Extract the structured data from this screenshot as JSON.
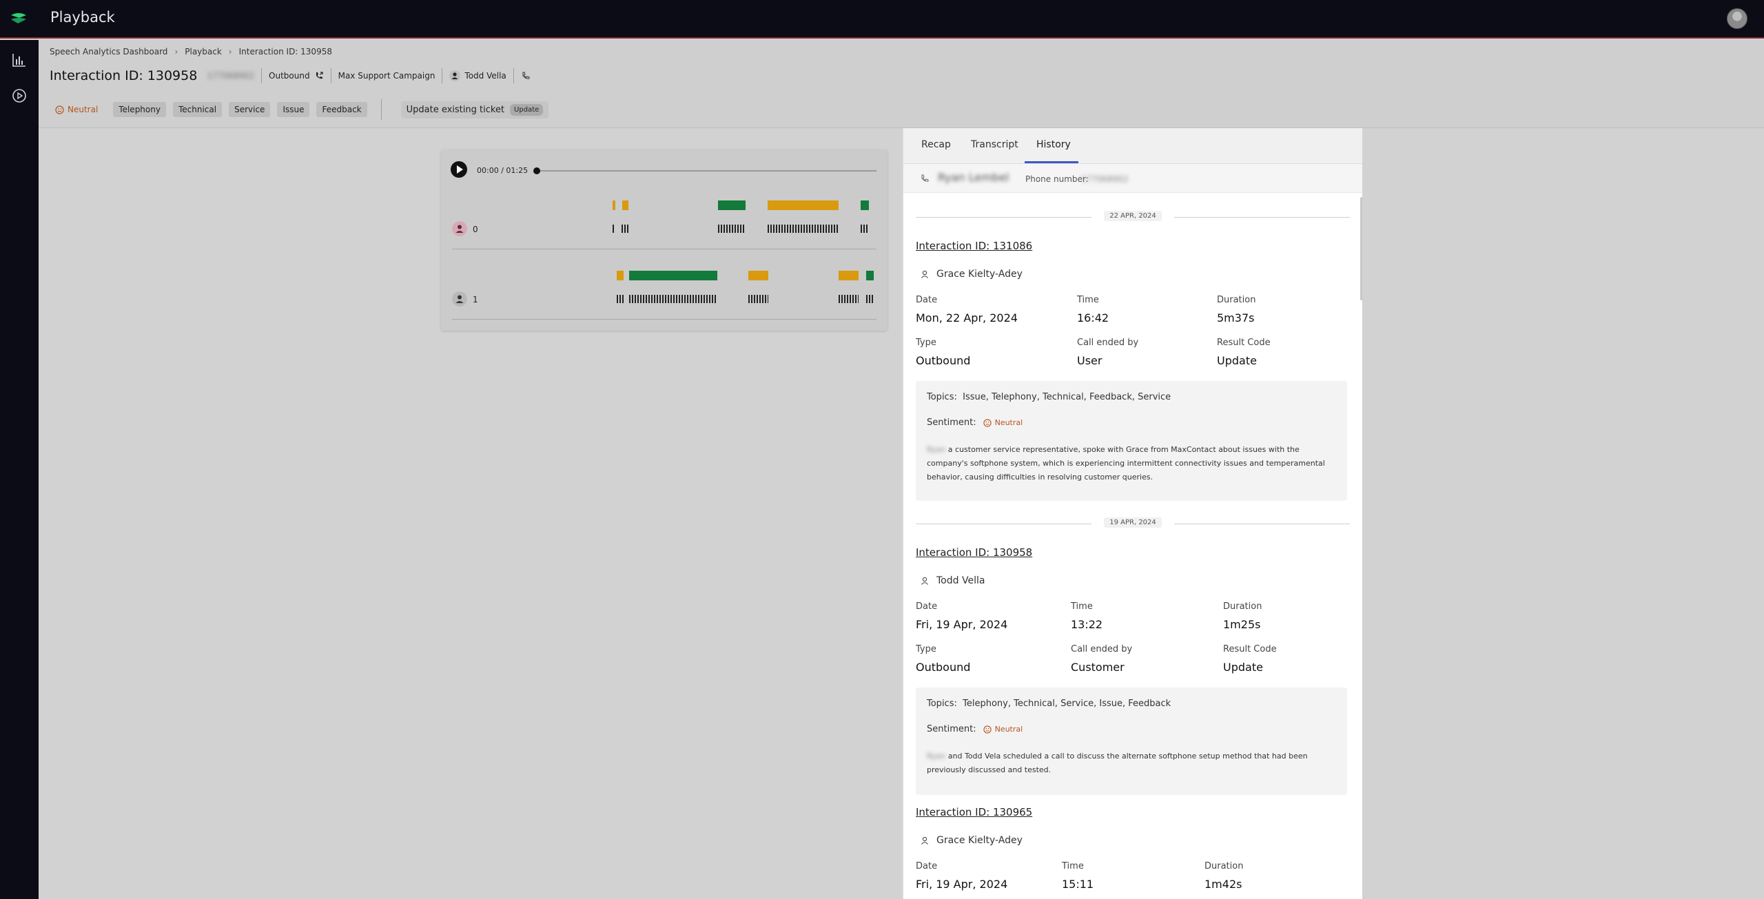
{
  "app": {
    "title": "Playback"
  },
  "breadcrumb": [
    "Speech Analytics Dashboard",
    "Playback",
    "Interaction ID: 130958"
  ],
  "header": {
    "title": "Interaction ID: 130958",
    "hidden_id": "177068902",
    "direction": "Outbound",
    "campaign": "Max Support Campaign",
    "agent": "Todd Vella",
    "sentiment": "Neutral",
    "tags": [
      "Telephony",
      "Technical",
      "Service",
      "Issue",
      "Feedback"
    ],
    "ticket_label": "Update existing ticket",
    "ticket_badge": "Update"
  },
  "player": {
    "time": "00:00 / 01:25",
    "progress": 0,
    "speakers": [
      {
        "label": "0"
      },
      {
        "label": "1"
      }
    ]
  },
  "panel": {
    "tabs": [
      "Recap",
      "Transcript",
      "History"
    ],
    "active_tab": "History",
    "contact_name": "Ryan Lembel",
    "phone_label": "Phone number:",
    "phone_value": "177068902",
    "labels": {
      "date": "Date",
      "time": "Time",
      "duration": "Duration",
      "type": "Type",
      "call_ended_by": "Call ended by",
      "result_code": "Result Code",
      "topics": "Topics:",
      "sentiment": "Sentiment:"
    },
    "groups": [
      {
        "date": "22 APR, 2024"
      },
      {
        "date": "19 APR, 2024"
      }
    ],
    "interactions": [
      {
        "id": "Interaction ID: 131086",
        "agent": "Grace Kielty-Adey",
        "date": "Mon, 22 Apr, 2024",
        "time": "16:42",
        "duration": "5m37s",
        "type": "Outbound",
        "call_ended_by": "User",
        "result_code": "Update",
        "topics": "Issue, Telephony, Technical, Feedback, Service",
        "sentiment": "Neutral",
        "summary_redacted": "Ryan",
        "summary": "a customer service representative, spoke with Grace from MaxContact about issues with the company's softphone system, which is experiencing intermittent connectivity issues and temperamental behavior, causing difficulties in resolving customer queries."
      },
      {
        "id": "Interaction ID: 130958",
        "agent": "Todd Vella",
        "date": "Fri, 19 Apr, 2024",
        "time": "13:22",
        "duration": "1m25s",
        "type": "Outbound",
        "call_ended_by": "Customer",
        "result_code": "Update",
        "topics": "Telephony, Technical, Service, Issue, Feedback",
        "sentiment": "Neutral",
        "summary_redacted": "Ryan",
        "summary": "and Todd Vela scheduled a call to discuss the alternate softphone setup method that had been previously discussed and tested."
      },
      {
        "id": "Interaction ID: 130965",
        "agent": "Grace Kielty-Adey",
        "date": "Fri, 19 Apr, 2024",
        "time": "15:11",
        "duration": "1m42s"
      }
    ]
  },
  "colors": {
    "accent": "#3a57c9",
    "neutral": "#b5541c",
    "speech_a": "#d99a10",
    "speech_b": "#127a3a"
  }
}
